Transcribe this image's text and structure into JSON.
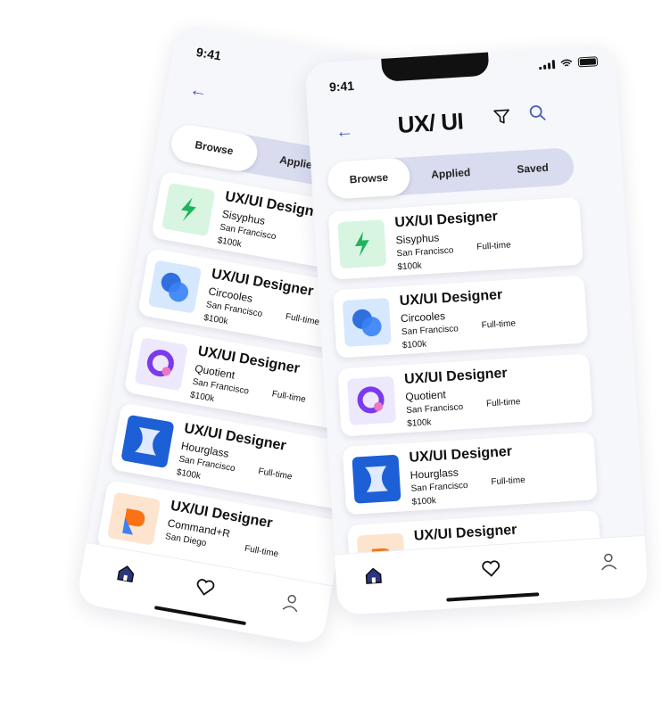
{
  "status": {
    "time": "9:41"
  },
  "header": {
    "title": "UX/ UI"
  },
  "tabs": [
    {
      "label": "Browse",
      "active": true
    },
    {
      "label": "Applied",
      "active": false
    },
    {
      "label": "Saved",
      "active": false
    }
  ],
  "jobs": [
    {
      "title": "UX/UI Designer",
      "company": "Sisyphus",
      "location": "San Francisco",
      "salary": "$100k",
      "type": "Full-time",
      "logo": "sisyphus-logo"
    },
    {
      "title": "UX/UI Designer",
      "company": "Circooles",
      "location": "San Francisco",
      "salary": "$100k",
      "type": "Full-time",
      "logo": "circooles-logo"
    },
    {
      "title": "UX/UI Designer",
      "company": "Quotient",
      "location": "San Francisco",
      "salary": "$100k",
      "type": "Full-time",
      "logo": "quotient-logo"
    },
    {
      "title": "UX/UI Designer",
      "company": "Hourglass",
      "location": "San Francisco",
      "salary": "$100k",
      "type": "Full-time",
      "logo": "hourglass-logo"
    },
    {
      "title": "UX/UI Designer",
      "company": "Command+R",
      "location": "San Diego",
      "salary": "",
      "type": "Full-time",
      "logo": "commandr-logo"
    }
  ],
  "nav": {
    "icons": [
      "home-icon",
      "heart-icon",
      "profile-icon"
    ]
  },
  "colors": {
    "accent": "#4b5bb8",
    "segment": "#d9dcef",
    "background": "#f6f7fb"
  }
}
